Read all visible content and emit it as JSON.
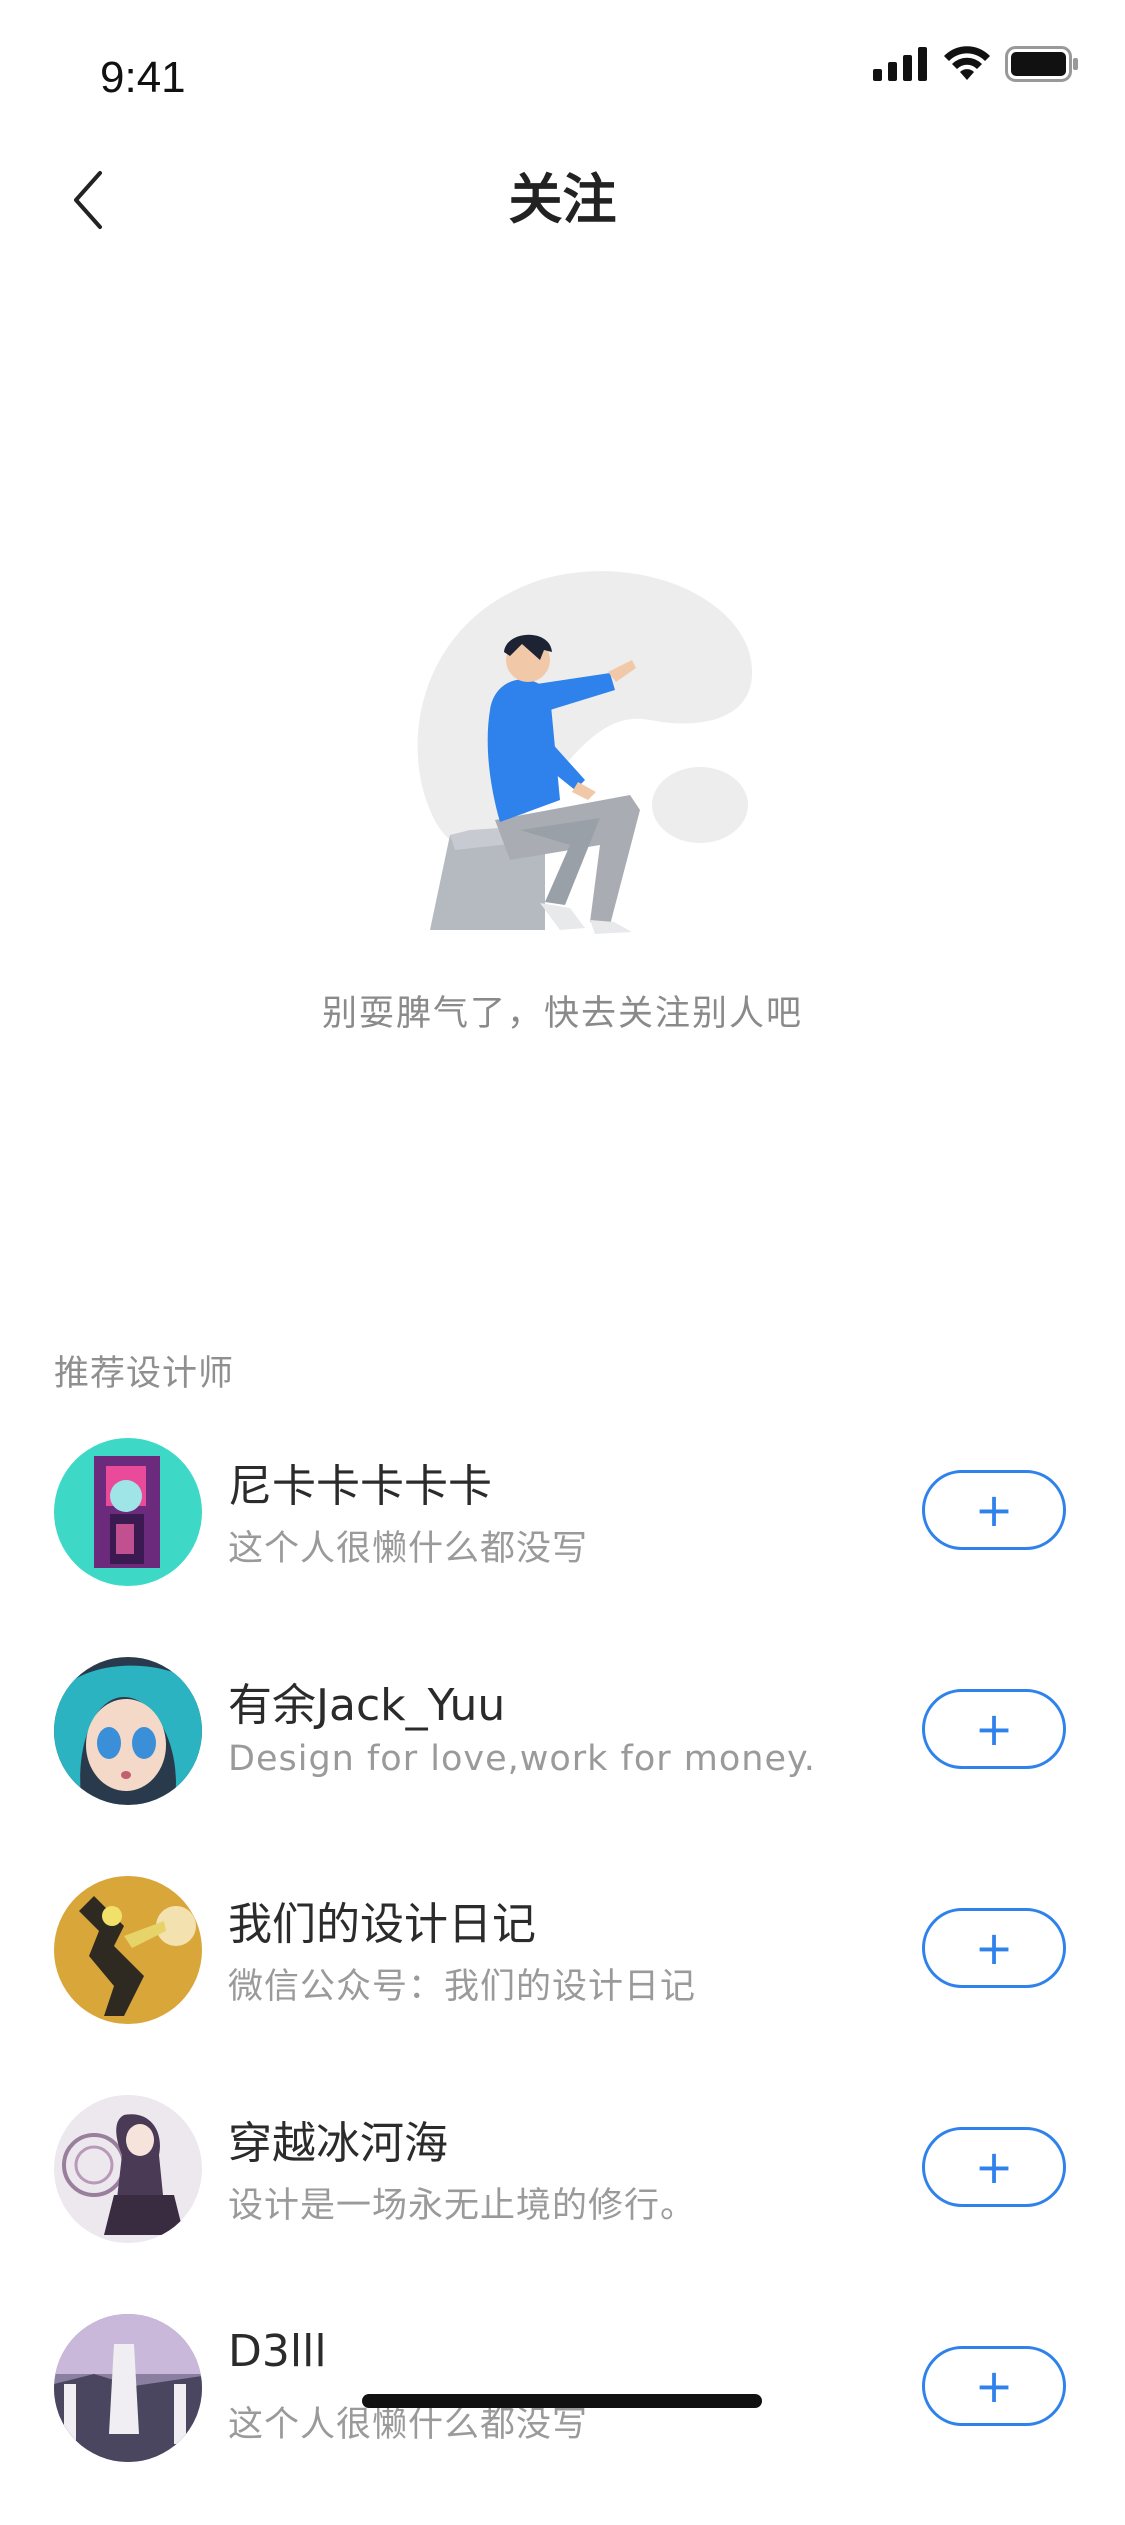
{
  "status_bar": {
    "time": "9:41",
    "icons": [
      "signal-icon",
      "wifi-icon",
      "battery-icon"
    ]
  },
  "nav": {
    "title": "关注",
    "back_icon": "chevron-left-icon"
  },
  "empty_state": {
    "message": "别耍脾气了，快去关注别人吧"
  },
  "recommend": {
    "section_title": "推荐设计师",
    "follow_icon": "plus-icon",
    "follow_label": "+",
    "designers": [
      {
        "name": "尼卡卡卡卡卡",
        "bio": "这个人很懒什么都没写",
        "avatar_color": "#3ed9c6"
      },
      {
        "name": "有余Jack_Yuu",
        "bio": "Design for love,work for money.",
        "avatar_color": "#2a3a4d"
      },
      {
        "name": "我们的设计日记",
        "bio": "微信公众号：我们的设计日记",
        "avatar_color": "#d9a63a"
      },
      {
        "name": "穿越冰河海",
        "bio": "设计是一场永无止境的修行。",
        "avatar_color": "#e6e1e6"
      },
      {
        "name": "D3lll",
        "bio": "这个人很懒什么都没写",
        "avatar_color": "#8a7fa0"
      }
    ]
  },
  "colors": {
    "accent": "#2f82ec",
    "text_primary": "#2b2b2b",
    "text_secondary": "#9a9a9a"
  }
}
